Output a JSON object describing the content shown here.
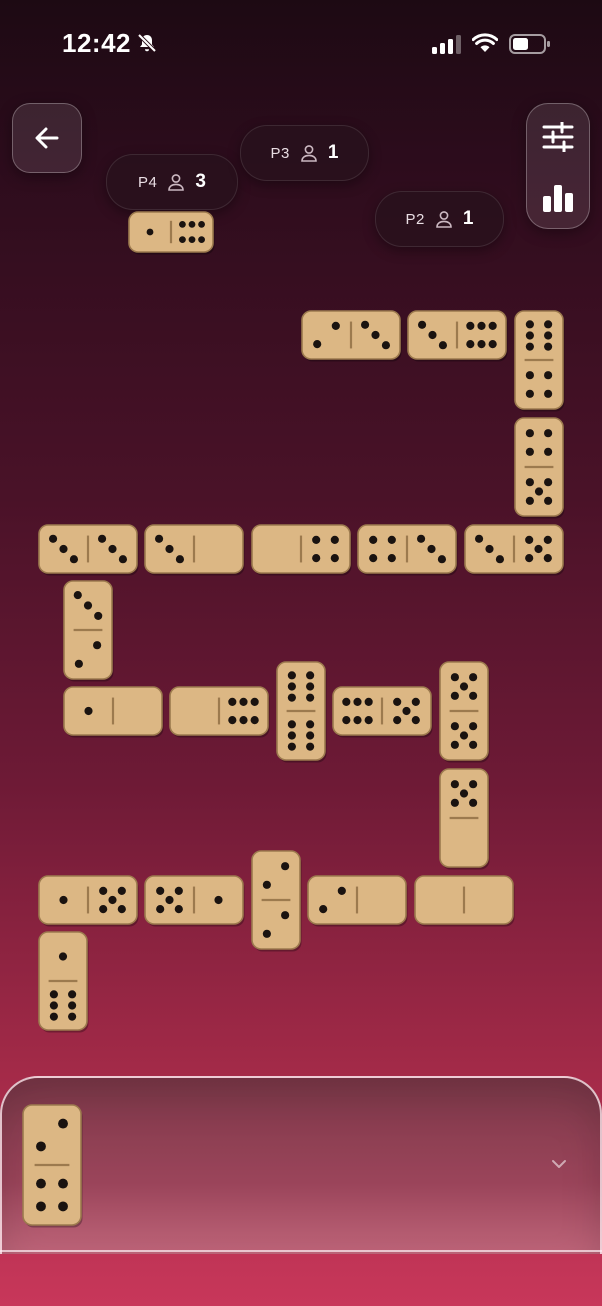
{
  "status_bar": {
    "time": "12:42"
  },
  "players": [
    {
      "name": "P4",
      "count": "3"
    },
    {
      "name": "P3",
      "count": "1"
    },
    {
      "name": "P2",
      "count": "1"
    }
  ],
  "colors": {
    "tile": "#dcb784",
    "tile_border": "#9c7a4e",
    "pip": "#1a1310"
  },
  "icons": {
    "back": "arrow-left-icon",
    "settings": "sliders-icon",
    "stats": "bar-chart-icon",
    "tray_toggle": "chevron-down-icon"
  },
  "board": {
    "opponent_tile": [
      1,
      6
    ],
    "tiles": [
      [
        2,
        3
      ],
      [
        3,
        6
      ],
      [
        6,
        4
      ],
      [
        4,
        5
      ],
      [
        3,
        3
      ],
      [
        3,
        0
      ],
      [
        0,
        4
      ],
      [
        4,
        3
      ],
      [
        3,
        5
      ],
      [
        3,
        2
      ],
      [
        1,
        0
      ],
      [
        0,
        6
      ],
      [
        6,
        6
      ],
      [
        6,
        5
      ],
      [
        5,
        5
      ],
      [
        5,
        0
      ],
      [
        1,
        5
      ],
      [
        5,
        1
      ],
      [
        2,
        2
      ],
      [
        2,
        0
      ],
      [
        0,
        0
      ],
      [
        1,
        6
      ]
    ]
  },
  "hand": [
    [
      2,
      4
    ]
  ]
}
